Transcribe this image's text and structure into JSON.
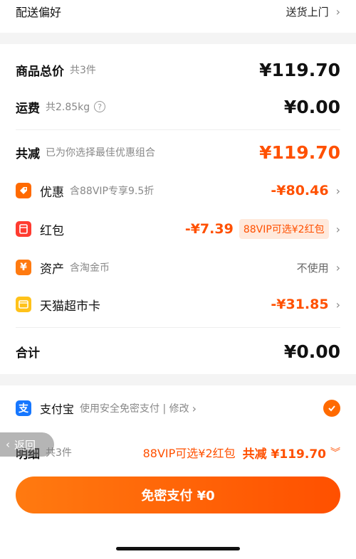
{
  "delivery": {
    "label": "配送偏好",
    "value": "送货上门"
  },
  "summary": {
    "goods_label": "商品总价",
    "goods_count": "共3件",
    "goods_amount": "¥119.70",
    "shipping_label": "运费",
    "shipping_weight": "共2.85kg",
    "shipping_amount": "¥0.00",
    "reduce_label": "共减",
    "reduce_sub": "已为你选择最佳优惠组合",
    "reduce_amount": "¥119.70"
  },
  "discounts": [
    {
      "label": "优惠",
      "sub": "含88VIP专享9.5折",
      "amount": "-¥80.46",
      "icon": "tag-icon"
    },
    {
      "label": "红包",
      "sub": "",
      "amount": "-¥7.39",
      "badge": "88VIP可选¥2红包",
      "icon": "red-packet-icon"
    },
    {
      "label": "资产",
      "sub": "含淘金币",
      "value": "不使用",
      "icon": "yen-asset-icon"
    },
    {
      "label": "天猫超市卡",
      "sub": "",
      "amount": "-¥31.85",
      "icon": "card-icon"
    }
  ],
  "total": {
    "label": "合计",
    "amount": "¥0.00"
  },
  "payment": {
    "method": "支付宝",
    "desc": "使用安全免密支付 | 修改"
  },
  "bottom": {
    "back": "返回",
    "detail_label": "明细",
    "detail_count": "共3件",
    "vip_hint": "88VIP可选¥2红包",
    "reduce_total": "共减 ¥119.70",
    "pay_button": "免密支付 ¥0"
  },
  "colors": {
    "accent": "#ff5000",
    "alipay": "#1677ff"
  }
}
